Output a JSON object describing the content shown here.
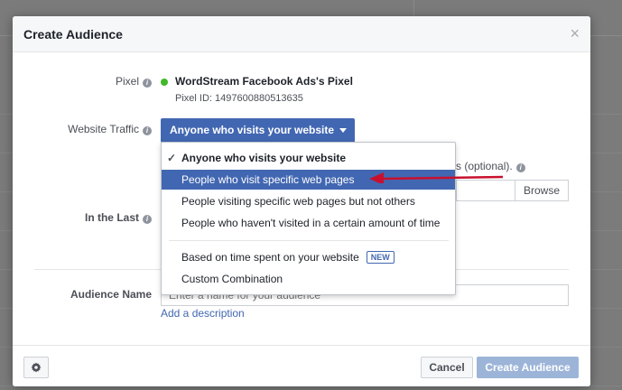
{
  "dialog": {
    "title": "Create Audience",
    "close_glyph": "×"
  },
  "pixel": {
    "label": "Pixel",
    "name": "WordStream Facebook Ads's Pixel",
    "id_text": "Pixel ID: 1497600880513635",
    "status_color": "#42b72a"
  },
  "website_traffic": {
    "label": "Website Traffic",
    "selected": "Anyone who visits your website"
  },
  "menu": {
    "check_glyph": "✓",
    "items": [
      {
        "label": "Anyone who visits your website",
        "state": "selected"
      },
      {
        "label": "People who visit specific web pages",
        "state": "hover"
      },
      {
        "label": "People visiting specific web pages but not others"
      },
      {
        "label": "People who haven't visited in a certain amount of time"
      },
      {
        "label": "Based on time spent on your website",
        "badge": "NEW"
      },
      {
        "label": "Custom Combination"
      }
    ]
  },
  "partial_field": {
    "visible_text": "s (optional).",
    "browse_label": "Browse"
  },
  "in_the_last": {
    "label": "In the Last"
  },
  "audience_name": {
    "label": "Audience Name",
    "placeholder": "Enter a name for your audience",
    "add_description": "Add a description"
  },
  "footer": {
    "cancel_label": "Cancel",
    "create_label": "Create Audience"
  },
  "colors": {
    "primary": "#4267b2",
    "disabled_primary": "#9cb4d8",
    "annotation_arrow": "#c8102e"
  },
  "icons": {
    "help": "help-circle-icon",
    "gear": "gear-icon",
    "close": "close-icon",
    "caret": "caret-down-icon",
    "check": "check-icon"
  }
}
